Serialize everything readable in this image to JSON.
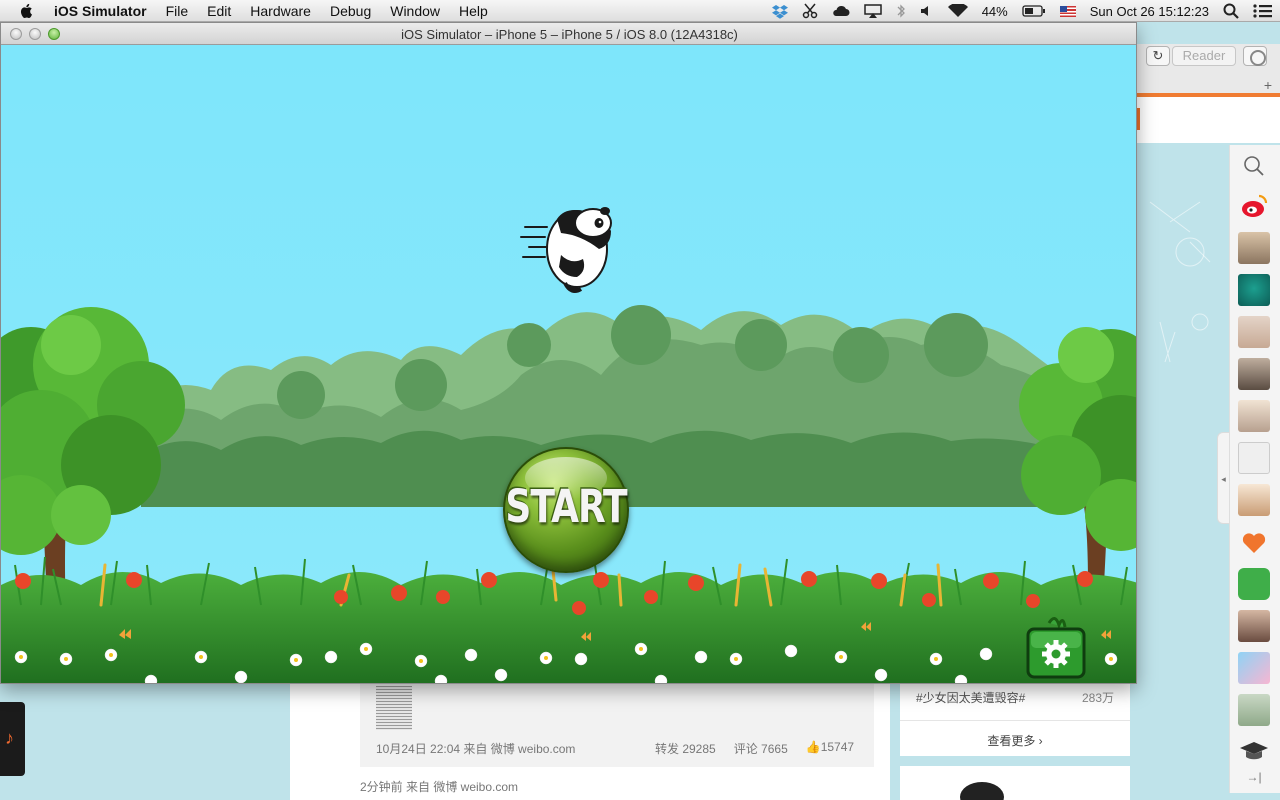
{
  "menubar": {
    "app_name": "iOS Simulator",
    "menus": [
      "File",
      "Edit",
      "Hardware",
      "Debug",
      "Window",
      "Help"
    ],
    "battery": "44%",
    "datetime": "Sun Oct 26  15:12:23"
  },
  "browser": {
    "reader_label": "Reader",
    "feed": {
      "post_time": "10月24日 22:04 来自 微博 weibo.com",
      "repost": "转发 29285",
      "comment": "评论 7665",
      "like": "15747",
      "next_post_time": "2分钟前 来自 微博 weibo.com"
    },
    "trending": {
      "topic": "#少女因太美遭毁容#",
      "count": "283万",
      "see_more": "查看更多 ›"
    }
  },
  "simulator": {
    "window_title": "iOS Simulator – iPhone 5 – iPhone 5 / iOS 8.0 (12A4318c)",
    "game": {
      "start_label": "START",
      "icons": [
        "panda-character",
        "settings-gear-icon"
      ]
    }
  },
  "colors": {
    "sky": "#7ee6fb",
    "forest_far": "#78b07a",
    "forest_near": "#4f8e50",
    "grass": "#2f8f2a",
    "start_green": "#6a9f24"
  }
}
